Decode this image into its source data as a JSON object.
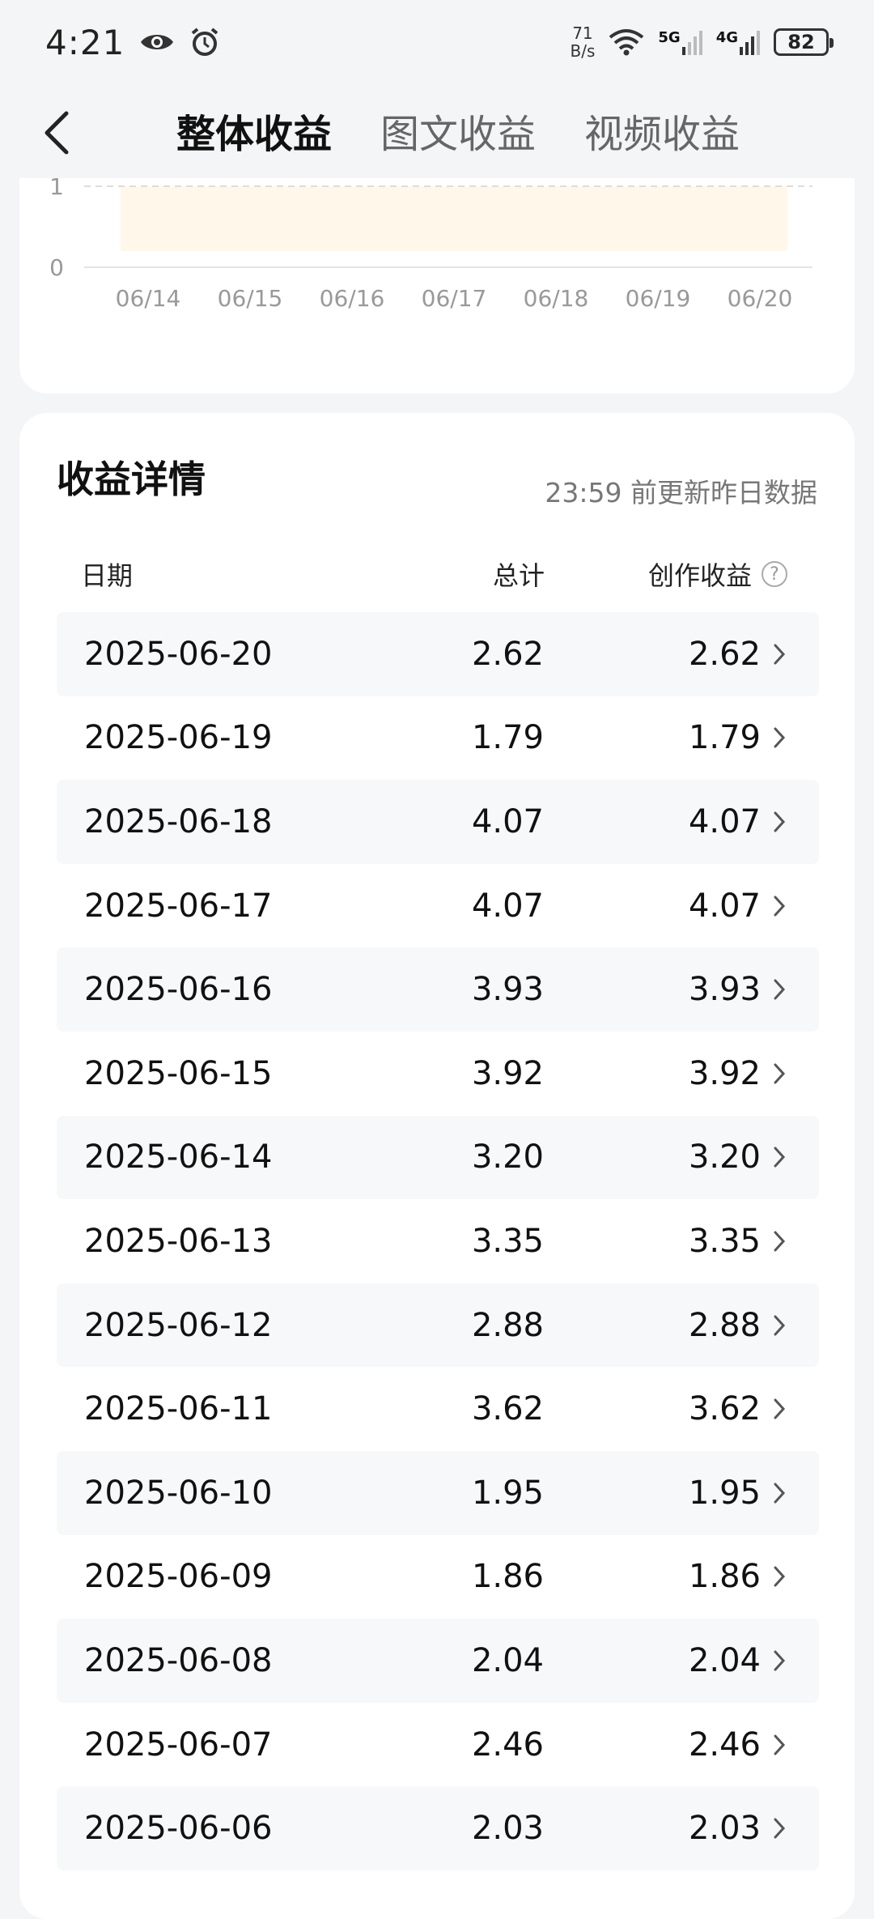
{
  "status": {
    "time": "4:21",
    "net_speed_value": "71",
    "net_speed_unit": "B/s",
    "sim1_label": "5G",
    "sim2_label": "4G",
    "battery": "82"
  },
  "nav": {
    "tabs": [
      {
        "label": "整体收益",
        "active": true
      },
      {
        "label": "图文收益",
        "active": false
      },
      {
        "label": "视频收益",
        "active": false
      }
    ]
  },
  "chart_data": {
    "type": "line",
    "x": [
      "06/14",
      "06/15",
      "06/16",
      "06/17",
      "06/18",
      "06/19",
      "06/20"
    ],
    "y_tick_labels": [
      "0",
      "1"
    ],
    "visible_y_range": [
      0,
      1
    ]
  },
  "details": {
    "title": "收益详情",
    "update_note": "23:59 前更新昨日数据",
    "columns": {
      "date": "日期",
      "total": "总计",
      "creation": "创作收益"
    },
    "help_symbol": "?",
    "rows": [
      {
        "date": "2025-06-20",
        "total": "2.62",
        "creation": "2.62"
      },
      {
        "date": "2025-06-19",
        "total": "1.79",
        "creation": "1.79"
      },
      {
        "date": "2025-06-18",
        "total": "4.07",
        "creation": "4.07"
      },
      {
        "date": "2025-06-17",
        "total": "4.07",
        "creation": "4.07"
      },
      {
        "date": "2025-06-16",
        "total": "3.93",
        "creation": "3.93"
      },
      {
        "date": "2025-06-15",
        "total": "3.92",
        "creation": "3.92"
      },
      {
        "date": "2025-06-14",
        "total": "3.20",
        "creation": "3.20"
      },
      {
        "date": "2025-06-13",
        "total": "3.35",
        "creation": "3.35"
      },
      {
        "date": "2025-06-12",
        "total": "2.88",
        "creation": "2.88"
      },
      {
        "date": "2025-06-11",
        "total": "3.62",
        "creation": "3.62"
      },
      {
        "date": "2025-06-10",
        "total": "1.95",
        "creation": "1.95"
      },
      {
        "date": "2025-06-09",
        "total": "1.86",
        "creation": "1.86"
      },
      {
        "date": "2025-06-08",
        "total": "2.04",
        "creation": "2.04"
      },
      {
        "date": "2025-06-07",
        "total": "2.46",
        "creation": "2.46"
      },
      {
        "date": "2025-06-06",
        "total": "2.03",
        "creation": "2.03"
      }
    ]
  },
  "colors": {
    "background": "#f4f5f7",
    "card": "#ffffff",
    "row_shade": "#f7f8fa",
    "chart_fill": "#fff7ea",
    "muted_text": "#777777"
  }
}
